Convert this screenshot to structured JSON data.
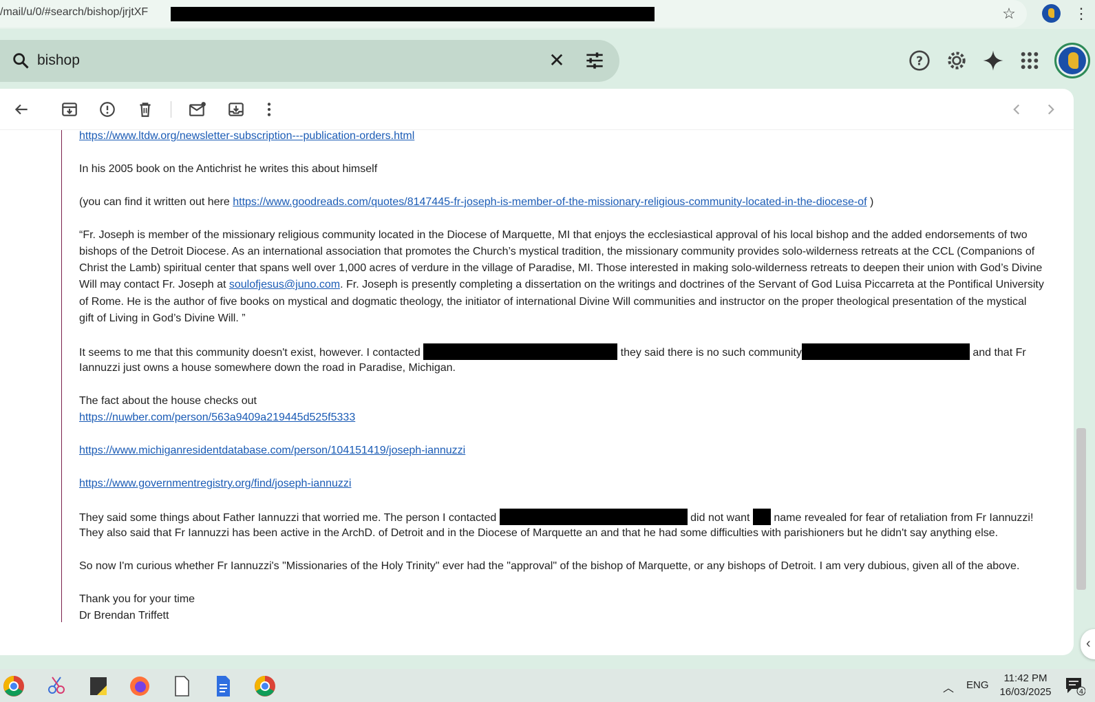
{
  "browser": {
    "url": "/mail/u/0/#search/bishop/jrjtXF"
  },
  "search": {
    "query": "bishop"
  },
  "email": {
    "line_link1": "https://www.ltdw.org/newsletter-subscription---publication-orders.html",
    "p1": "In his 2005 book on the Antichrist he writes this about himself",
    "p2_prefix": "(you can find it written out here ",
    "p2_link": "https://www.goodreads.com/quotes/8147445-fr-joseph-is-member-of-the-missionary-religious-community-located-in-the-diocese-of",
    "p2_suffix": " )",
    "q_line1": "“Fr. Joseph is member of the missionary religious community located in the Diocese of Marquette, MI that enjoys the ecclesiastical approval of his local bishop and the added endorsements of two",
    "q_line2": "bishops of the Detroit Diocese. As an international association that promotes the Church’s mystical tradition, the missionary community provides solo-wilderness retreats at the CCL (Companions of",
    "q_line3": "Christ the Lamb) spiritual center that spans well over 1,000 acres of verdure in the village of Paradise, MI. Those interested in making solo-wilderness retreats to deepen their union with God’s Divine",
    "q_line4_prefix": "Will may contact Fr. Joseph at ",
    "q_line4_email": "soulofjesus@juno.com",
    "q_line4_suffix": ". Fr. Joseph is presently completing a dissertation on the writings and doctrines of the Servant of God Luisa Piccarreta at the Pontifical University",
    "q_line5": "of Rome. He is the author of five books on mystical and dogmatic theology, the initiator of international Divine Will communities and instructor on the proper theological presentation of the mystical",
    "q_line6": "gift of Living in God’s Divine Will. ”",
    "p4_a": "It seems to me that this community doesn't exist, however. I contacted ",
    "p4_b": " they said there is no such community",
    "p4_c": "and that Fr",
    "p4_line2": "Iannuzzi just owns a house somewhere down the road in Paradise, Michigan.",
    "p5": "The fact about the house checks out",
    "link_nuwber": "https://nuwber.com/person/563a9409a219445d525f5333",
    "link_michigan": "https://www.michiganresidentdatabase.com/person/104151419/joseph-iannuzzi",
    "link_gov": "https://www.governmentregistry.org/find/joseph-iannuzzi",
    "p6_a": "They said some things about Father Iannuzzi that worried me. The person I contacted ",
    "p6_b": "did not want ",
    "p6_c": "name revealed for fear of retaliation from Fr Iannuzzi!",
    "p6_line2": "They also said that Fr Iannuzzi has been active in the ArchD. of Detroit and in the Diocese of Marquette an and that he had some difficulties with parishioners but he didn't say anything else.",
    "p7": "So now I'm curious whether Fr Iannuzzi's \"Missionaries of the Holy Trinity\" ever had the \"approval\" of the bishop of Marquette, or any bishops of Detroit. I am very dubious, given all of the above.",
    "sign1": "Thank you for your time",
    "sign2": "Dr Brendan Triffett"
  },
  "taskbar": {
    "lang": "ENG",
    "time": "11:42 PM",
    "date": "16/03/2025",
    "notif_count": "4"
  }
}
